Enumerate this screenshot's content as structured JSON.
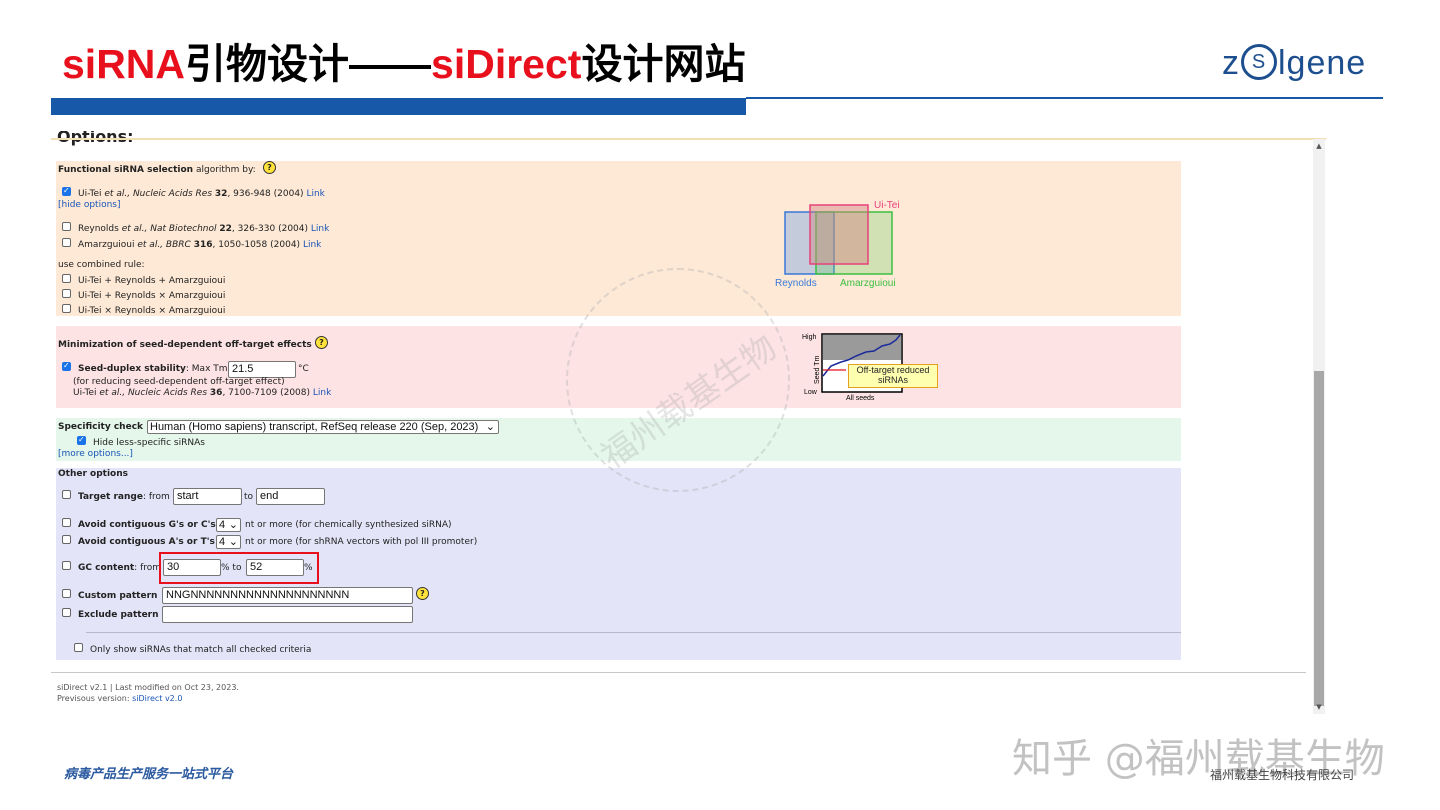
{
  "slide": {
    "title_part1": "siRNA",
    "title_part2": "引物设计——",
    "title_part3": "siDirect",
    "title_part4": "设计网站",
    "logo_pre": "z",
    "logo_circle": "S",
    "logo_post": "lgene",
    "footer_left": "病毒产品生产服务一站式平台",
    "footer_right": "福州载基生物科技有限公司",
    "watermark": "知乎 @福州载基生物",
    "seal_text": "福州载基生物"
  },
  "colors": {
    "title_red": "#e8101c",
    "brand_blue": "#1858a8",
    "link": "#1a55b8",
    "highlight_box": "#e8101c"
  },
  "options": {
    "heading": "Options:",
    "functional": {
      "title": "Functional siRNA selection",
      "title_suffix": "algorithm by:",
      "help": "?",
      "uitei": {
        "checked": true,
        "author": "Ui-Tei",
        "etal": "et al.,",
        "journal": "Nucleic Acids Res",
        "vol": "32",
        "pages": ", 936-948 (2004)",
        "link": "Link"
      },
      "hide_options": "[hide options]",
      "reynolds": {
        "checked": false,
        "author": "Reynolds",
        "etal": "et al.,",
        "journal": "Nat Biotechnol",
        "vol": "22",
        "pages": ", 326-330 (2004)",
        "link": "Link"
      },
      "amarz": {
        "checked": false,
        "author": "Amarzguioui",
        "etal": "et al.,",
        "journal": "BBRC",
        "vol": "316",
        "pages": ", 1050-1058 (2004)",
        "link": "Link"
      },
      "combined_label": "use combined rule:",
      "combined": [
        "Ui-Tei + Reynolds + Amarzguioui",
        "Ui-Tei + Reynolds × Amarzguioui",
        "Ui-Tei × Reynolds × Amarzguioui"
      ],
      "venn": {
        "uitei": "Ui-Tei",
        "reynolds": "Reynolds",
        "amarz": "Amarzguioui",
        "color_uitei": "#e8407a",
        "color_reynolds": "#3a78d8",
        "color_amarz": "#3cc040"
      }
    },
    "seed": {
      "title": "Minimization of seed-dependent off-target effects",
      "help": "?",
      "stability_label": "Seed-duplex stability",
      "maxtm_label": ": Max Tm",
      "maxtm_value": "21.5",
      "unit": "°C",
      "note": "(for reducing seed-dependent off-target effect)",
      "ref_author": "Ui-Tei",
      "ref_etal": "et al.,",
      "ref_journal": "Nucleic Acids Res",
      "ref_vol": "36",
      "ref_pages": ", 7100-7109 (2008)",
      "ref_link": "Link",
      "checked": true,
      "graph": {
        "high": "High",
        "low": "Low",
        "ylabel": "Seed Tm",
        "xlabel": "All seeds",
        "callout": "Off-target reduced siRNAs"
      }
    },
    "specificity": {
      "label": "Specificity check",
      "selected": "Human (Homo sapiens) transcript, RefSeq release 220 (Sep, 2023)",
      "hide_less": "Hide less-specific siRNAs",
      "hide_checked": true,
      "more_options": "[more options...]"
    },
    "other": {
      "title": "Other options",
      "target_range_label": "Target range",
      "from": ": from",
      "start": "start",
      "to": "to",
      "end": "end",
      "gc_contig_label": "Avoid contiguous G's or C's",
      "gc_contig_value": "4",
      "gc_contig_suffix": "nt or more (for chemically synthesized siRNA)",
      "at_contig_label": "Avoid contiguous A's or T's",
      "at_contig_value": "4",
      "at_contig_suffix": "nt or more (for shRNA vectors with pol III promoter)",
      "gc_label": "GC content",
      "gc_from": ": from",
      "gc_min": "30",
      "gc_to": "% to",
      "gc_max": "52",
      "gc_pct": "%",
      "custom_label": "Custom pattern",
      "custom_value": "NNGNNNNNNNNNNNNNNNNNNNN",
      "custom_help": "?",
      "exclude_label": "Exclude pattern",
      "exclude_value": "",
      "only_show": "Only show siRNAs that match all checked criteria"
    },
    "version_line": "siDirect v2.1 | Last modified on Oct 23, 2023.",
    "prev_label": "Previsous version:",
    "prev_link": "siDirect v2.0"
  }
}
